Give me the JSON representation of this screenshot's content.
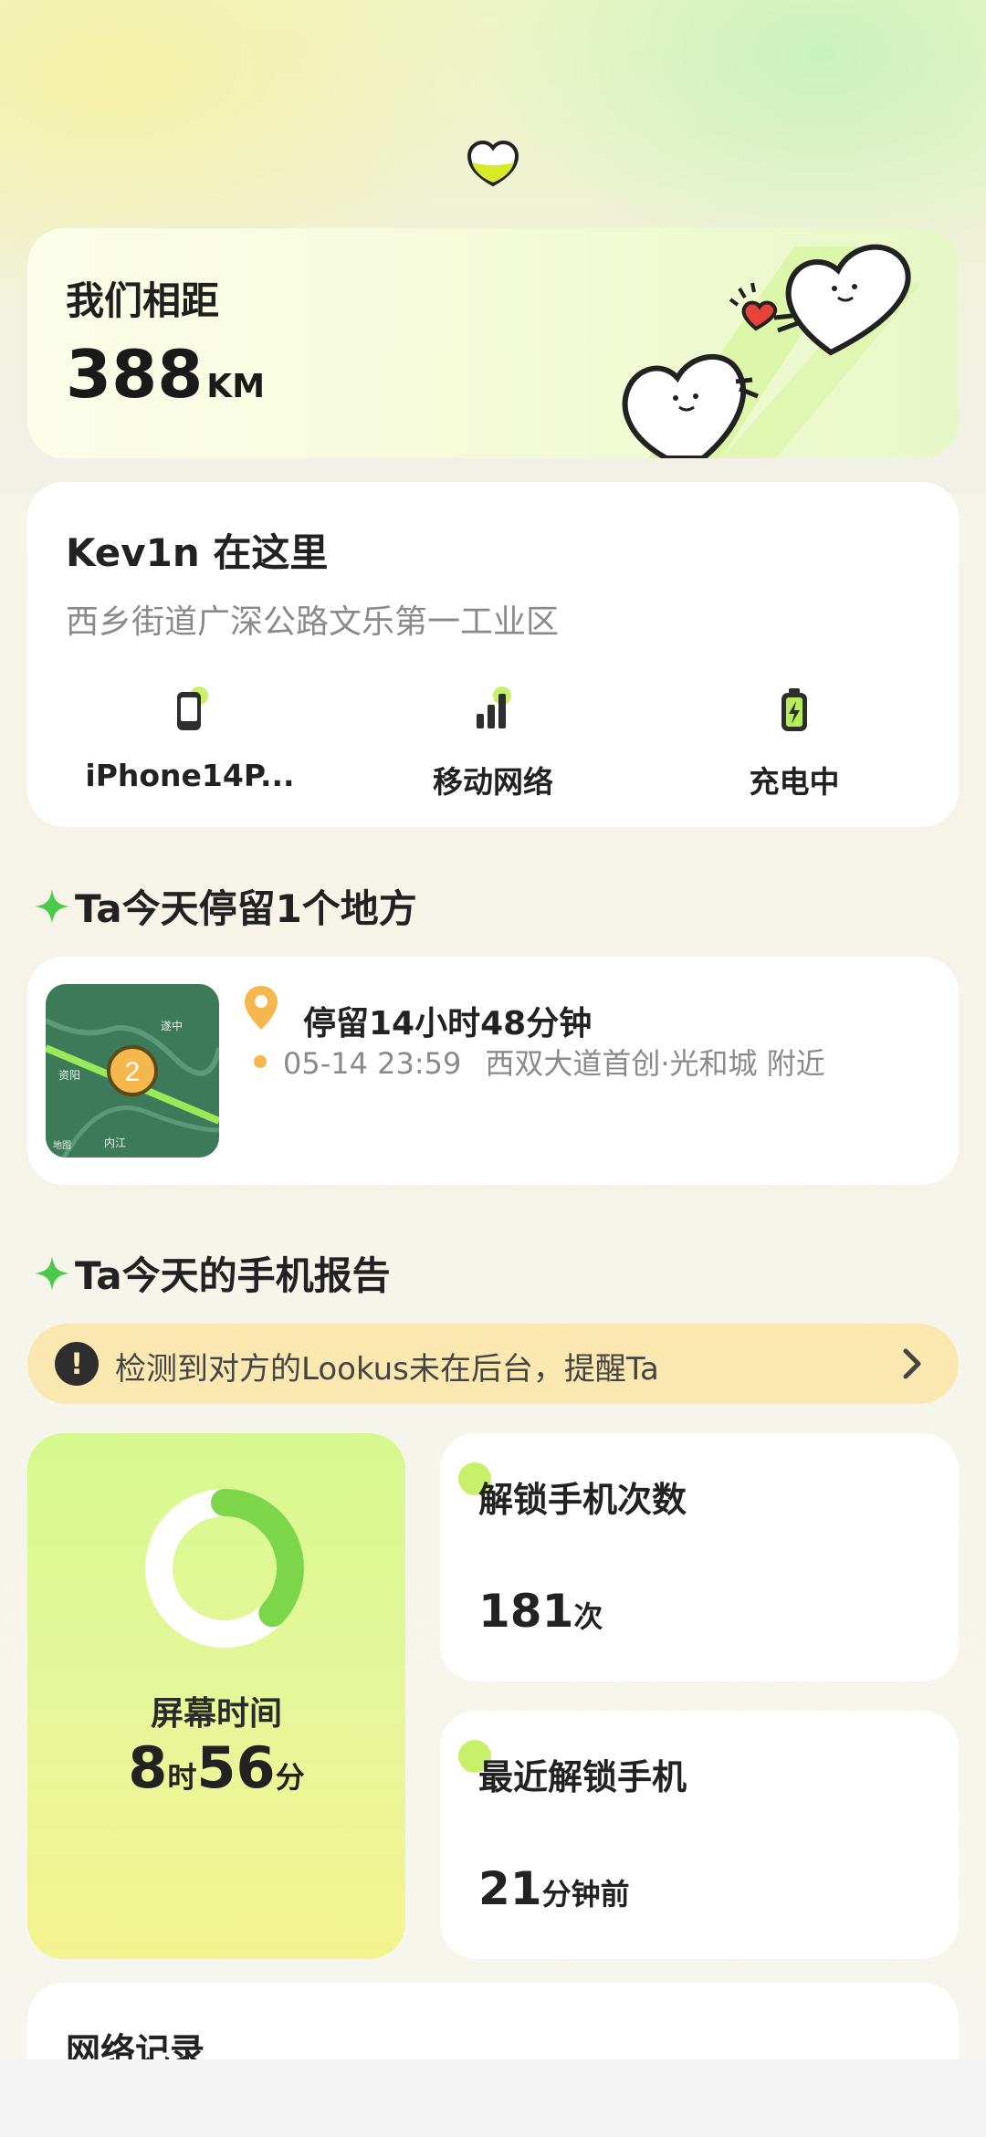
{
  "distance": {
    "title": "我们相距",
    "value": "388",
    "unit": "KM"
  },
  "location": {
    "name": "Kev1n 在这里",
    "address": "西乡街道广深公路文乐第一工业区",
    "stats": [
      {
        "icon": "phone-icon",
        "label": "iPhone14P..."
      },
      {
        "icon": "signal-icon",
        "label": "移动网络"
      },
      {
        "icon": "battery-charging-icon",
        "label": "充电中"
      }
    ]
  },
  "stay_section": {
    "title": "Ta今天停留1个地方"
  },
  "stay": {
    "duration": "停留14小时48分钟",
    "time": "05-14 23:59",
    "place": "西双大道首创·光和城 附近",
    "map": {
      "badge": "2",
      "labels": [
        "遂中",
        "资阳",
        "内江",
        "地图"
      ]
    }
  },
  "report_section": {
    "title": "Ta今天的手机报告"
  },
  "alert": {
    "text": "检测到对方的Lookus未在后台，提醒Ta"
  },
  "screen_time": {
    "label": "屏幕时间",
    "hours": "8",
    "hours_unit": "时",
    "minutes": "56",
    "minutes_unit": "分",
    "progress": 0.37
  },
  "unlock_count": {
    "title": "解锁手机次数",
    "value": "181",
    "unit": "次"
  },
  "last_unlock": {
    "title": "最近解锁手机",
    "value": "21",
    "unit": "分钟前"
  },
  "network": {
    "title": "网络记录"
  },
  "colors": {
    "accent": "#c8f06a",
    "ring": "#7dd64a",
    "alert_bg": "#fbe7b0",
    "pin": "#f6b84d"
  }
}
